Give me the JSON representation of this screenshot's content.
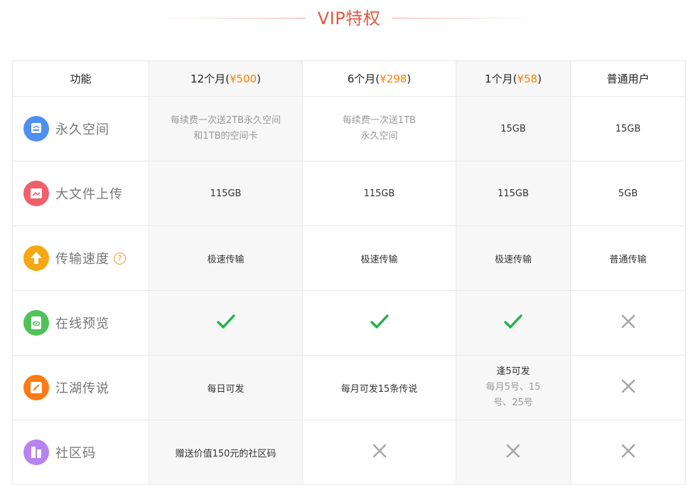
{
  "title": "VIP特权",
  "colors": {
    "accent": "#e15a42",
    "price": "#ff7f00",
    "check": "#22b14c",
    "cross": "#a8a8a8"
  },
  "header": {
    "feature": "功能",
    "plan12": {
      "label_pre": "12个月(",
      "price": "¥500",
      "label_post": ")"
    },
    "plan6": {
      "label_pre": "6个月(",
      "price": "¥298",
      "label_post": ")"
    },
    "plan1": {
      "label_pre": "1个月(",
      "price": "¥58",
      "label_post": ")"
    },
    "normal": "普通用户"
  },
  "rows": [
    {
      "name": "永久空间",
      "icon": "storage-icon",
      "icon_color": "#4f8ff0",
      "plan12": [
        "每续费一次送2TB永久空间",
        "和1TB的空间卡"
      ],
      "plan6": [
        "每续费一次送1TB",
        "永久空间"
      ],
      "plan1": "15GB",
      "normal": "15GB"
    },
    {
      "name": "大文件上传",
      "icon": "upload-icon",
      "icon_color": "#f0606a",
      "plan12": "115GB",
      "plan6": "115GB",
      "plan1": "115GB",
      "normal": "5GB"
    },
    {
      "name": "传输速度",
      "icon": "speed-icon",
      "icon_color": "#f7a812",
      "help": "?",
      "plan12": "极速传输",
      "plan6": "极速传输",
      "plan1": "极速传输",
      "normal": "普通传输"
    },
    {
      "name": "在线预览",
      "icon": "preview-icon",
      "icon_color": "#52c15a",
      "plan12": "check",
      "plan6": "check",
      "plan1": "check",
      "normal": "cross"
    },
    {
      "name": "江湖传说",
      "icon": "legend-icon",
      "icon_color": "#ff7a14",
      "plan12": "每日可发",
      "plan6": "每月可发15条传说",
      "plan1": [
        "逢5可发",
        "每月5号、15",
        "号、25号"
      ],
      "normal": "cross"
    },
    {
      "name": "社区码",
      "icon": "community-code-icon",
      "icon_color": "#b683f0",
      "plan12": "赠送价值150元的社区码",
      "plan6": "cross",
      "plan1": "cross",
      "normal": "cross"
    }
  ]
}
